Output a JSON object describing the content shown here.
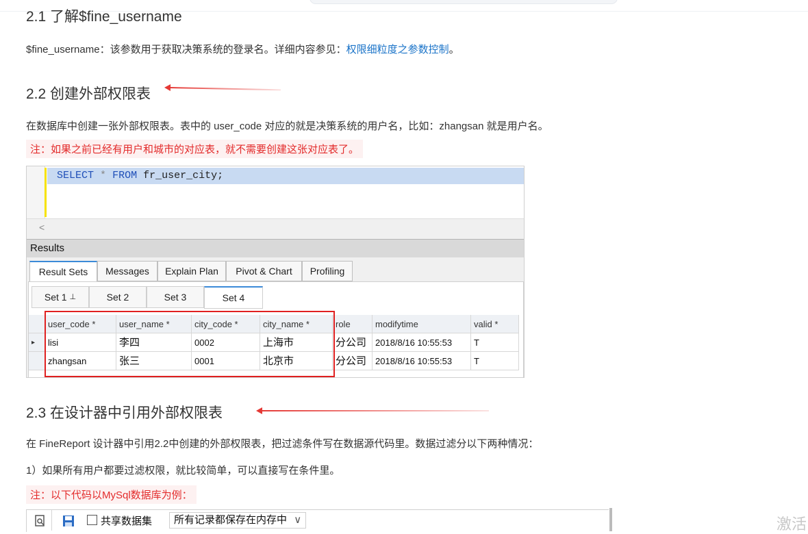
{
  "section_21": {
    "heading": "2.1 了解$fine_username",
    "desc_prefix": "$fine_username：该参数用于获取决策系统的登录名。详细内容参见：",
    "desc_link": "权限细粒度之参数控制",
    "desc_suffix": "。"
  },
  "section_22": {
    "heading": "2.2 创建外部权限表",
    "desc": "在数据库中创建一张外部权限表。表中的 user_code 对应的就是决策系统的用户名，比如：zhangsan 就是用户名。",
    "note": "注：如果之前已经有用户和城市的对应表，就不需要创建这张对应表了。"
  },
  "sql_screenshot": {
    "sql": {
      "select": "SELECT",
      "star": "*",
      "from": "FROM",
      "table": "fr_user_city;"
    },
    "scroll_arrow": "<",
    "results_title": "Results",
    "result_tabs": [
      "Result Sets",
      "Messages",
      "Explain Plan",
      "Pivot & Chart",
      "Profiling"
    ],
    "set_tabs": [
      "Set 1",
      "Set 2",
      "Set 3",
      "Set 4"
    ],
    "pin_icon": "⊥",
    "row_marker": "▸",
    "columns": [
      "user_code *",
      "user_name *",
      "city_code *",
      "city_name *",
      "role",
      "modifytime",
      "valid *"
    ],
    "rows": [
      [
        "lisi",
        "李四",
        "0002",
        "上海市",
        "分公司",
        "2018/8/16 10:55:53",
        "T"
      ],
      [
        "zhangsan",
        "张三",
        "0001",
        "北京市",
        "分公司",
        "2018/8/16 10:55:53",
        "T"
      ]
    ]
  },
  "section_23": {
    "heading": "2.3 在设计器中引用外部权限表",
    "desc": "在 FineReport 设计器中引用2.2中创建的外部权限表，把过滤条件写在数据源代码里。数据过滤分以下两种情况：",
    "item1": "1）如果所有用户都要过滤权限，就比较简单，可以直接写在条件里。",
    "note": "注：以下代码以MySql数据库为例："
  },
  "designer_toolbar": {
    "preview_icon": "preview-icon",
    "save_icon": "save-icon",
    "checkbox_label": "共享数据集",
    "select_value": "所有记录都保存在内存中",
    "chevron": "∨"
  },
  "watermark": "激活"
}
